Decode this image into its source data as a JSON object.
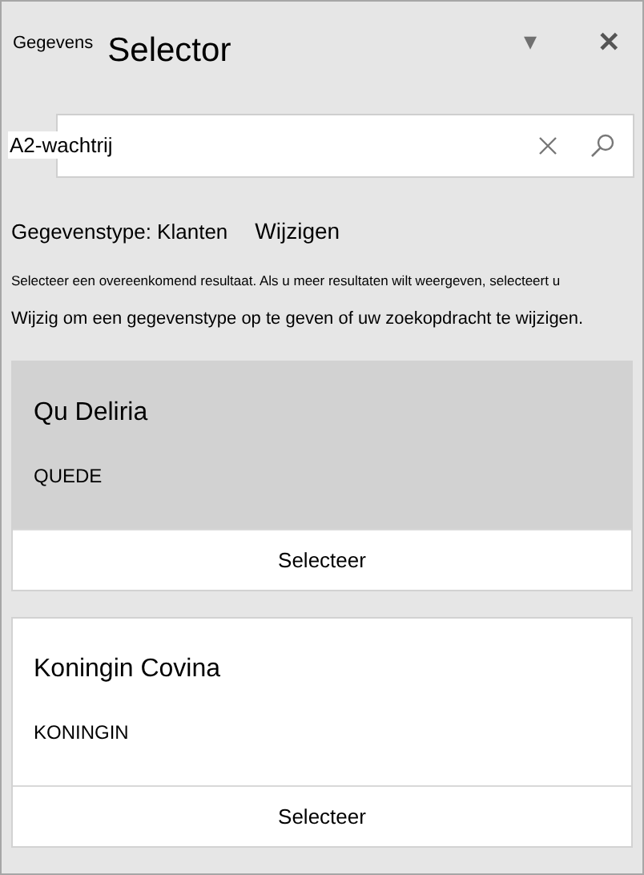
{
  "header": {
    "prefix": "Gegevens",
    "title": "Selector",
    "dropdown": "▾",
    "close": "✕"
  },
  "search": {
    "value": "A2-wachtrij"
  },
  "data_type": {
    "label": "Gegevenstype: Klanten",
    "change_link": "Wijzigen"
  },
  "instructions": [
    "Selecteer een overeenkomend resultaat. Als u meer resultaten wilt weergeven, selecteert u",
    "Wijzig om een gegevenstype op te geven of uw zoekopdracht te wijzigen."
  ],
  "results": [
    {
      "name": "Qu Deliria",
      "code": "QUEDE",
      "button": "Selecteer",
      "selected": true
    },
    {
      "name": "Koningin Covina",
      "code": "KONINGIN",
      "button": "Selecteer",
      "selected": false
    }
  ]
}
